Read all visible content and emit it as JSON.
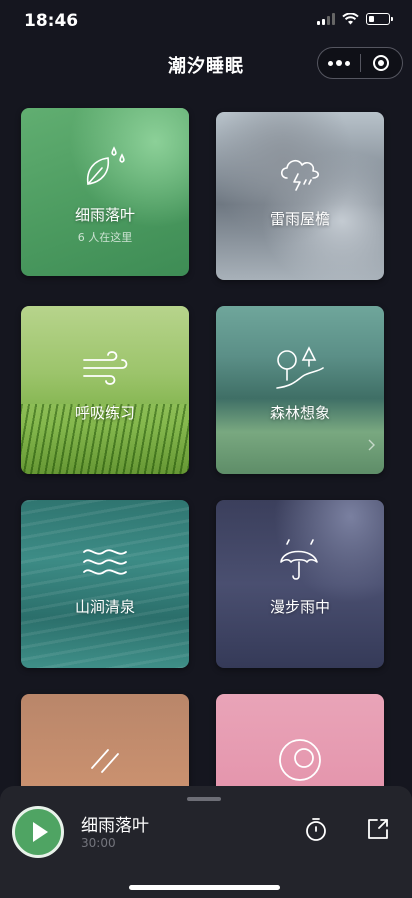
{
  "status_bar": {
    "time": "18:46"
  },
  "nav": {
    "title": "潮汐睡眠"
  },
  "cards": [
    {
      "label": "细雨落叶",
      "subtitle": "6 人在这里",
      "icon": "leaf-rain-icon"
    },
    {
      "label": "雷雨屋檐",
      "icon": "thunderstorm-cloud-icon"
    },
    {
      "label": "呼吸练习",
      "icon": "wind-icon"
    },
    {
      "label": "森林想象",
      "icon": "forest-path-icon"
    },
    {
      "label": "山涧清泉",
      "icon": "water-waves-icon"
    },
    {
      "label": "漫步雨中",
      "icon": "umbrella-rain-icon"
    },
    {
      "label": "",
      "icon": "diagonal-lines-icon"
    },
    {
      "label": "",
      "icon": "moon-circle-icon"
    }
  ],
  "player": {
    "title": "细雨落叶",
    "duration": "30:00"
  },
  "colors": {
    "accent_green": "#4fa463",
    "background": "#15161f",
    "player_bg": "#23242b"
  }
}
